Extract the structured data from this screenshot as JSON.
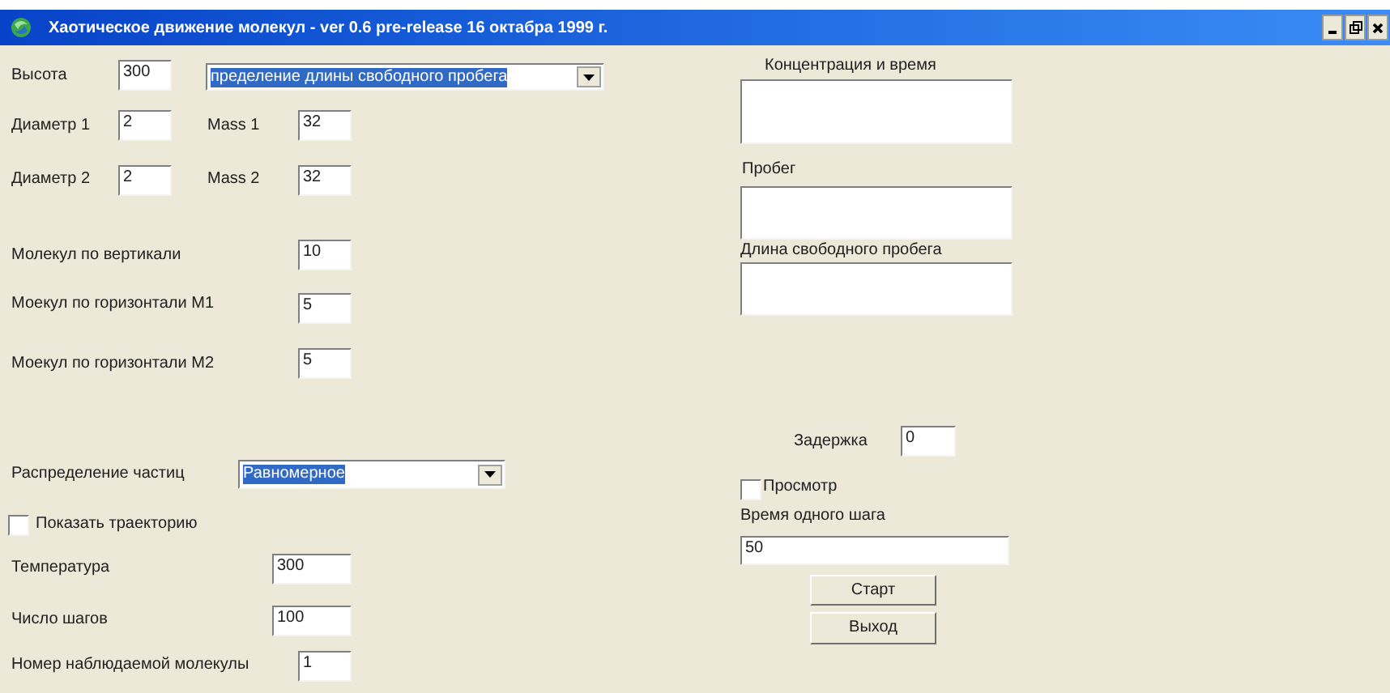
{
  "window": {
    "title": "Хаотическое движение молекул - ver 0.6 pre-release 16 октабра 1999 г."
  },
  "form_items": [
    {
      "kind": "field",
      "label": "Высота",
      "value": "300"
    },
    {
      "kind": "dropdown",
      "value": "пределение длины свободного пробега"
    },
    {
      "kind": "field",
      "label": "Диаметр 1",
      "value": "2"
    },
    {
      "kind": "field",
      "label": "Mass 1",
      "value": "32"
    },
    {
      "kind": "field",
      "label": "Диаметр 2",
      "value": "2"
    },
    {
      "kind": "field",
      "label": "Mass 2",
      "value": "32"
    },
    {
      "kind": "field",
      "label": "Молекул по вертикали",
      "value": "10"
    },
    {
      "kind": "field",
      "label": "Моекул по горизонтали M1",
      "value": "5"
    },
    {
      "kind": "field",
      "label": "Моекул по горизонтали M2",
      "value": "5"
    },
    {
      "kind": "dropdown",
      "label": "Распределение частиц",
      "value": "Равномерное"
    },
    {
      "kind": "checkbox",
      "label": "Показать траекторию",
      "checked": false
    },
    {
      "kind": "field",
      "label": "Температура",
      "value": "300"
    },
    {
      "kind": "field",
      "label": "Число шагов",
      "value": "100"
    },
    {
      "kind": "field",
      "label": "Номер наблюдаемой молекулы",
      "value": "1"
    },
    {
      "kind": "output",
      "label": "Концентрация и время"
    },
    {
      "kind": "output",
      "label": "Пробег"
    },
    {
      "kind": "output",
      "label": "Длина свободного пробега"
    },
    {
      "kind": "field",
      "label": "Задержка",
      "value": "0"
    },
    {
      "kind": "checkbox",
      "label": "Просмотр",
      "checked": false
    },
    {
      "kind": "field",
      "label": "Время одного шага",
      "value": "50"
    },
    {
      "kind": "button",
      "label": "Старт"
    },
    {
      "kind": "button",
      "label": "Выход"
    }
  ]
}
